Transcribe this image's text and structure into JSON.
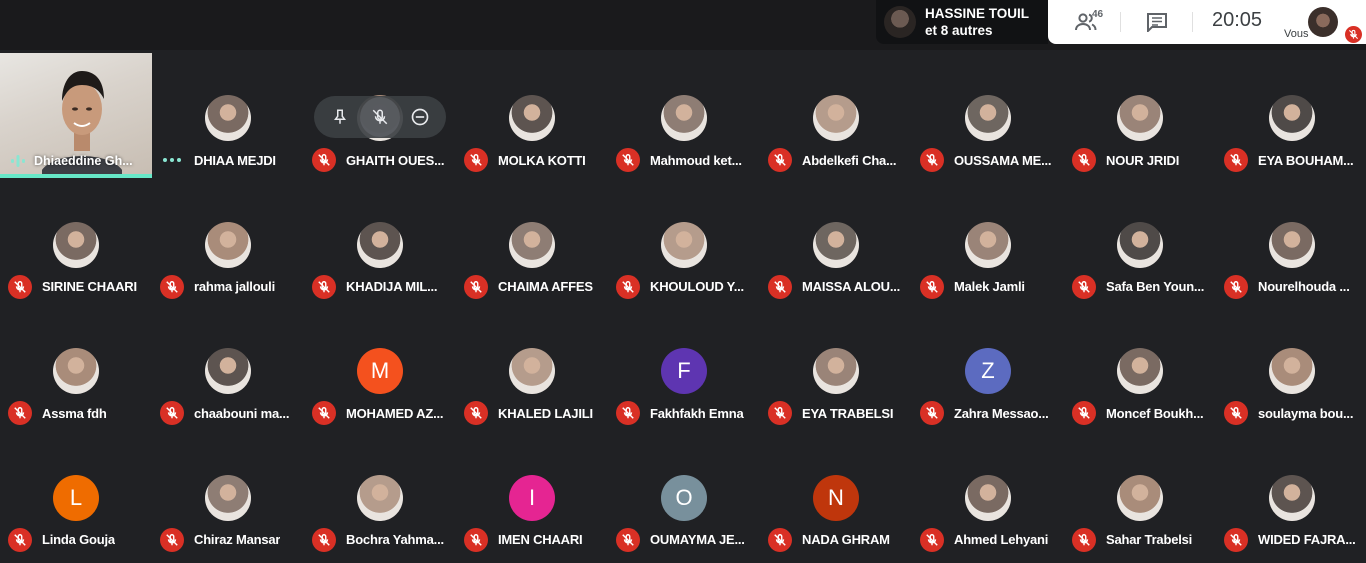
{
  "header": {
    "presenter_name": "HASSINE TOUIL",
    "presenter_sub": "et 8 autres",
    "people_count": "46",
    "clock": "20:05",
    "self_label": "Vous"
  },
  "speaker": {
    "name": "Dhiaeddine Gh..."
  },
  "tile_controls": [
    "pin-icon",
    "mic-off-icon",
    "remove-icon"
  ],
  "colors": {
    "muted": "#d93025",
    "speaking": "#67e8c8",
    "background": "#202124"
  },
  "participants": [
    {
      "name": "DHIAA MEJDI",
      "muted": false,
      "letter": "",
      "color": ""
    },
    {
      "name": "GHAITH OUES...",
      "muted": true,
      "letter": "",
      "color": ""
    },
    {
      "name": "MOLKA KOTTI",
      "muted": true,
      "letter": "",
      "color": ""
    },
    {
      "name": "Mahmoud ket...",
      "muted": true,
      "letter": "",
      "color": ""
    },
    {
      "name": "Abdelkefi Cha...",
      "muted": true,
      "letter": "",
      "color": ""
    },
    {
      "name": "OUSSAMA ME...",
      "muted": true,
      "letter": "",
      "color": ""
    },
    {
      "name": "NOUR JRIDI",
      "muted": true,
      "letter": "",
      "color": ""
    },
    {
      "name": "EYA BOUHAM...",
      "muted": true,
      "letter": "",
      "color": ""
    },
    {
      "name": "SIRINE CHAARI",
      "muted": true,
      "letter": "",
      "color": ""
    },
    {
      "name": "rahma jallouli",
      "muted": true,
      "letter": "",
      "color": ""
    },
    {
      "name": "KHADIJA MIL...",
      "muted": true,
      "letter": "",
      "color": ""
    },
    {
      "name": "CHAIMA AFFES",
      "muted": true,
      "letter": "",
      "color": ""
    },
    {
      "name": "KHOULOUD Y...",
      "muted": true,
      "letter": "",
      "color": ""
    },
    {
      "name": "MAISSA ALOU...",
      "muted": true,
      "letter": "",
      "color": ""
    },
    {
      "name": "Malek Jamli",
      "muted": true,
      "letter": "",
      "color": ""
    },
    {
      "name": "Safa Ben Youn...",
      "muted": true,
      "letter": "",
      "color": ""
    },
    {
      "name": "Nourelhouda ...",
      "muted": true,
      "letter": "",
      "color": ""
    },
    {
      "name": "Assma fdh",
      "muted": true,
      "letter": "",
      "color": ""
    },
    {
      "name": "chaabouni ma...",
      "muted": true,
      "letter": "",
      "color": ""
    },
    {
      "name": "MOHAMED AZ...",
      "muted": true,
      "letter": "M",
      "color": "#f4511e"
    },
    {
      "name": "KHALED LAJILI",
      "muted": true,
      "letter": "",
      "color": ""
    },
    {
      "name": "Fakhfakh Emna",
      "muted": true,
      "letter": "F",
      "color": "#5e35b1"
    },
    {
      "name": "EYA TRABELSI",
      "muted": true,
      "letter": "",
      "color": ""
    },
    {
      "name": "Zahra Messao...",
      "muted": true,
      "letter": "Z",
      "color": "#5c6bc0"
    },
    {
      "name": "Moncef Boukh...",
      "muted": true,
      "letter": "",
      "color": ""
    },
    {
      "name": "soulayma bou...",
      "muted": true,
      "letter": "",
      "color": ""
    },
    {
      "name": "Linda Gouja",
      "muted": true,
      "letter": "L",
      "color": "#ef6c00"
    },
    {
      "name": "Chiraz Mansar",
      "muted": true,
      "letter": "",
      "color": ""
    },
    {
      "name": "Bochra Yahma...",
      "muted": true,
      "letter": "",
      "color": ""
    },
    {
      "name": "IMEN CHAARI",
      "muted": true,
      "letter": "I",
      "color": "#e52592"
    },
    {
      "name": "OUMAYMA JE...",
      "muted": true,
      "letter": "O",
      "color": "#78909c"
    },
    {
      "name": "NADA GHRAM",
      "muted": true,
      "letter": "N",
      "color": "#bf360c"
    },
    {
      "name": "Ahmed Lehyani",
      "muted": true,
      "letter": "",
      "color": ""
    },
    {
      "name": "Sahar Trabelsi",
      "muted": true,
      "letter": "",
      "color": ""
    },
    {
      "name": "WIDED FAJRA...",
      "muted": true,
      "letter": "",
      "color": ""
    }
  ]
}
